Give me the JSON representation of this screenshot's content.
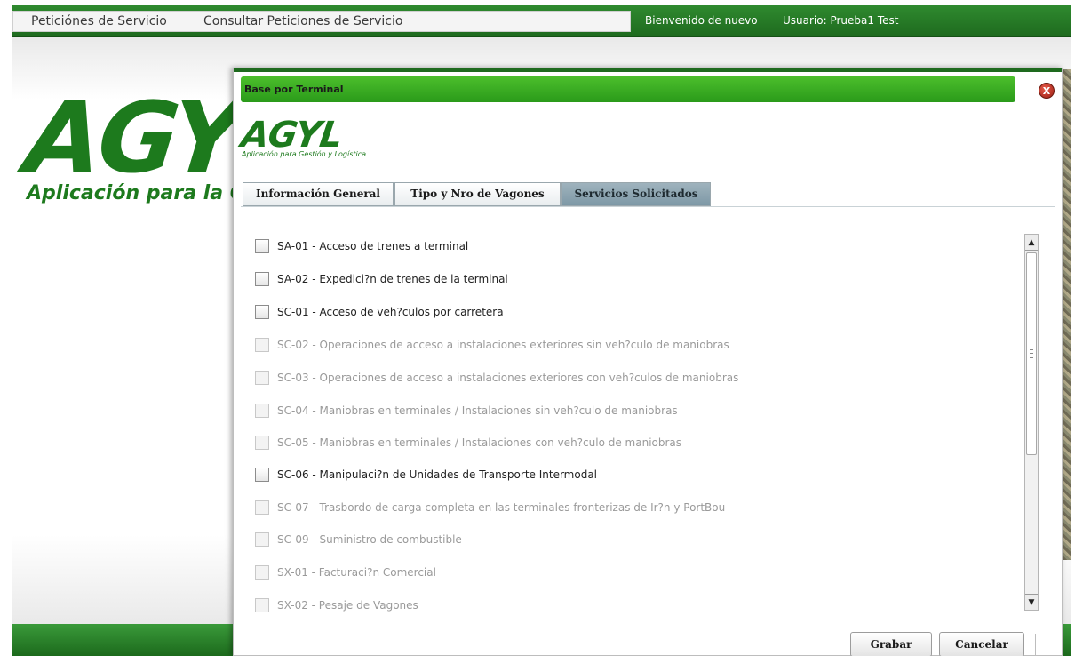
{
  "topbar": {
    "nav": [
      "Peticiónes de Servicio",
      "Consultar Peticiones de Servicio"
    ],
    "welcome": "Bienvenido de nuevo",
    "user": "Usuario: Prueba1 Test"
  },
  "background": {
    "logo": "AGYL",
    "subtitle": "Aplicación para la Gestión y Logística"
  },
  "modal": {
    "title": "Base por Terminal",
    "close_label": "X",
    "logo": "AGYL",
    "logo_sub": "Aplicación para Gestión y Logística",
    "tabs": [
      {
        "label": "Información General",
        "active": false
      },
      {
        "label": "Tipo y  Nro de Vagones",
        "active": false
      },
      {
        "label": "Servicios Solicitados",
        "active": true
      }
    ],
    "services": [
      {
        "label": "SA-01 - Acceso de trenes a terminal",
        "enabled": true,
        "checked": false
      },
      {
        "label": "SA-02 - Expedici?n de trenes de la terminal",
        "enabled": true,
        "checked": false
      },
      {
        "label": "SC-01 - Acceso de veh?culos por carretera",
        "enabled": true,
        "checked": false
      },
      {
        "label": "SC-02 - Operaciones de acceso a instalaciones exteriores sin veh?culo de maniobras",
        "enabled": false,
        "checked": false
      },
      {
        "label": "SC-03 - Operaciones de acceso a instalaciones exteriores con veh?culos de maniobras",
        "enabled": false,
        "checked": false
      },
      {
        "label": "SC-04 - Maniobras en terminales / Instalaciones sin veh?culo de maniobras",
        "enabled": false,
        "checked": false
      },
      {
        "label": "SC-05 - Maniobras en terminales / Instalaciones con veh?culo de maniobras",
        "enabled": false,
        "checked": false
      },
      {
        "label": "SC-06 - Manipulaci?n de Unidades de Transporte Intermodal",
        "enabled": true,
        "checked": false
      },
      {
        "label": "SC-07 - Trasbordo de carga completa en las terminales fronterizas de Ir?n y PortBou",
        "enabled": false,
        "checked": false
      },
      {
        "label": "SC-09 - Suministro de combustible",
        "enabled": false,
        "checked": false
      },
      {
        "label": "SX-01 - Facturaci?n Comercial",
        "enabled": false,
        "checked": false
      },
      {
        "label": "SX-02 - Pesaje de Vagones",
        "enabled": false,
        "checked": false
      }
    ],
    "buttons": {
      "save": "Grabar",
      "cancel": "Cancelar"
    }
  },
  "colors": {
    "brand_green": "#1d7a1d",
    "titlebar_green": "#3aae24",
    "active_tab": "#8ea6b2"
  }
}
